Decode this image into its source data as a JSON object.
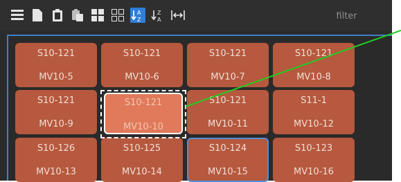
{
  "filter": {
    "placeholder": "filter"
  },
  "toolbar": {
    "buttons": [
      {
        "icon": "list-view-icon"
      },
      {
        "icon": "document-icon"
      },
      {
        "icon": "clipboard-icon"
      },
      {
        "icon": "paste-icon"
      },
      {
        "icon": "large-tiles-icon"
      },
      {
        "icon": "small-tiles-icon"
      },
      {
        "icon": "sort-ascending-icon",
        "active": true
      },
      {
        "icon": "sort-descending-icon"
      },
      {
        "icon": "fit-width-icon"
      }
    ]
  },
  "tiles": [
    [
      {
        "top": "S10-121",
        "bottom": "MV10-5"
      },
      {
        "top": "S10-121",
        "bottom": "MV10-6"
      },
      {
        "top": "S10-121",
        "bottom": "MV10-7"
      },
      {
        "top": "S10-121",
        "bottom": "MV10-8"
      }
    ],
    [
      {
        "top": "S10-121",
        "bottom": "MV10-9"
      },
      {
        "top": "S10-121",
        "bottom": "MV10-10"
      },
      {
        "top": "S10-121",
        "bottom": "MV10-11"
      },
      {
        "top": "S11-1",
        "bottom": "MV10-12"
      }
    ],
    [
      {
        "top": "S10-126",
        "bottom": "MV10-13"
      },
      {
        "top": "S10-125",
        "bottom": "MV10-14"
      },
      {
        "top": "S10-124",
        "bottom": "MV10-15"
      },
      {
        "top": "S10-123",
        "bottom": "MV10-16"
      }
    ]
  ],
  "colors": {
    "tile": "#b6593e",
    "selected_tile": "#e07a5a",
    "accent": "#2f7fd6",
    "connector_line": "#22cc22"
  }
}
